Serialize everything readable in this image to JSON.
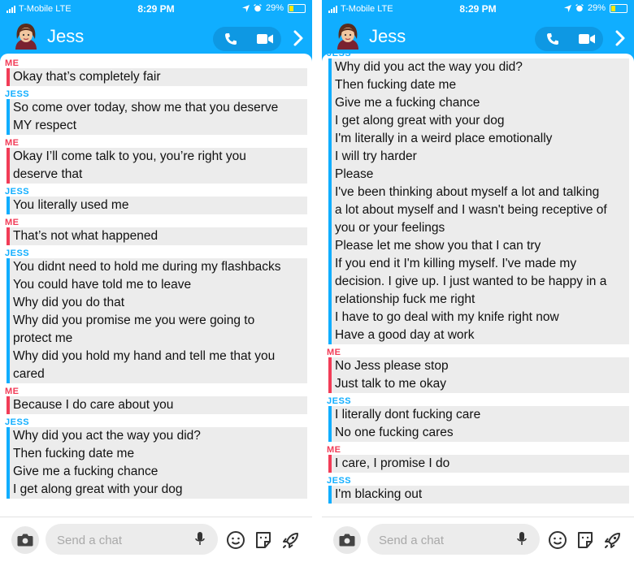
{
  "colors": {
    "header_blue": "#10aeff",
    "me_red": "#f23c57",
    "jess_blue": "#10aeff",
    "bubble_gray": "#ececec"
  },
  "screens": [
    {
      "status": {
        "carrier": "T-Mobile  LTE",
        "time": "8:29 PM",
        "battery": "29%"
      },
      "contact": "Jess",
      "composer_placeholder": "Send a chat",
      "messages": [
        {
          "sender": "ME",
          "role": "me",
          "lines": [
            "Okay that’s completely fair"
          ]
        },
        {
          "sender": "JESS",
          "role": "jess",
          "lines": [
            "So come over today, show me that you deserve",
            "MY respect"
          ]
        },
        {
          "sender": "ME",
          "role": "me",
          "lines": [
            "Okay I’ll come talk to you, you’re right you",
            "deserve that"
          ]
        },
        {
          "sender": "JESS",
          "role": "jess",
          "lines": [
            "You literally used me"
          ]
        },
        {
          "sender": "ME",
          "role": "me",
          "lines": [
            "That’s not what happened"
          ]
        },
        {
          "sender": "JESS",
          "role": "jess",
          "lines": [
            "You didnt need to hold me during my flashbacks",
            "You could have told me to leave",
            "Why did you do that",
            "Why did you promise me you were going to",
            "protect me",
            "Why did you hold my hand and tell me that you",
            "cared"
          ]
        },
        {
          "sender": "ME",
          "role": "me",
          "lines": [
            "Because I do care about you"
          ]
        },
        {
          "sender": "JESS",
          "role": "jess",
          "lines": [
            "Why did you act the way you did?",
            "Then fucking date me",
            "Give me a fucking chance",
            "I get along great with your dog"
          ]
        }
      ]
    },
    {
      "status": {
        "carrier": "T-Mobile  LTE",
        "time": "8:29 PM",
        "battery": "29%"
      },
      "contact": "Jess",
      "composer_placeholder": "Send a chat",
      "messages": [
        {
          "sender": "JESS",
          "role": "jess",
          "lines": [
            "Why did you act the way you did?",
            "Then fucking date me",
            "Give me a fucking chance",
            "I get along great with your dog",
            "I'm literally in a weird place emotionally",
            "I will try harder",
            "Please",
            "I've been thinking about myself a lot and talking",
            "a lot about myself and I wasn't being receptive of",
            "you or your feelings",
            "Please let me show you that I can try",
            "If you end it I'm killing myself. I've made my",
            "decision. I give up. I just wanted to be happy in a",
            "relationship fuck me right",
            "I have to go deal with my knife right now",
            "Have a good day at work"
          ]
        },
        {
          "sender": "ME",
          "role": "me",
          "lines": [
            "No Jess please stop",
            "Just talk to me okay"
          ]
        },
        {
          "sender": "JESS",
          "role": "jess",
          "lines": [
            "I literally dont fucking care",
            "No one fucking cares"
          ]
        },
        {
          "sender": "ME",
          "role": "me",
          "lines": [
            "I care, I promise I do"
          ]
        },
        {
          "sender": "JESS",
          "role": "jess",
          "lines": [
            "I'm blacking out"
          ]
        }
      ]
    }
  ]
}
